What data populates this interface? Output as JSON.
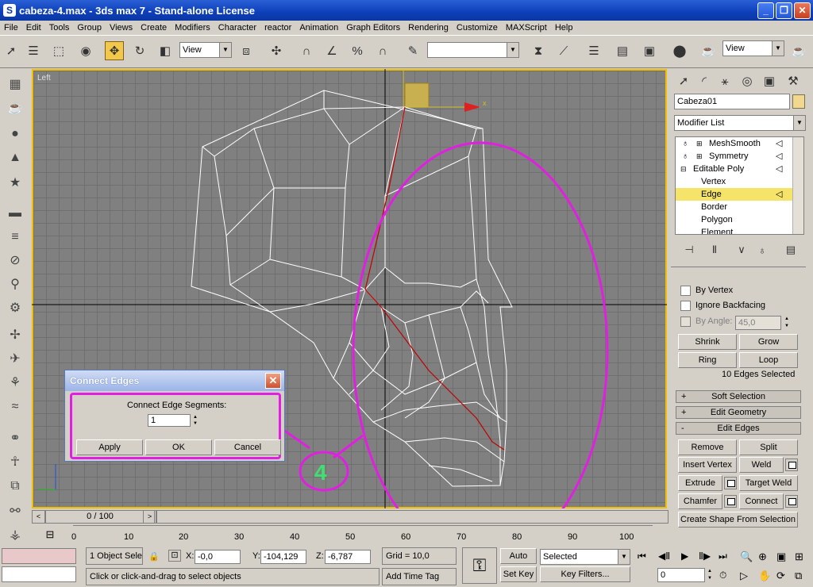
{
  "window": {
    "title": "cabeza-4.max - 3ds max 7 - Stand-alone License",
    "min": "_",
    "max": "❐",
    "close": "✕"
  },
  "menu": [
    "File",
    "Edit",
    "Tools",
    "Group",
    "Views",
    "Create",
    "Modifiers",
    "Character",
    "reactor",
    "Animation",
    "Graph Editors",
    "Rendering",
    "Customize",
    "MAXScript",
    "Help"
  ],
  "toolbar": {
    "ref_coord": "View",
    "named_selection": "",
    "render_view": "View"
  },
  "viewport": {
    "label": "Left",
    "axis_x": "x",
    "annotation_number": "4"
  },
  "dialog": {
    "title": "Connect Edges",
    "close": "✕",
    "segments_label": "Connect Edge Segments:",
    "segments_value": "1",
    "apply": "Apply",
    "ok": "OK",
    "cancel": "Cancel"
  },
  "command_panel": {
    "object_name": "Cabeza01",
    "modifier_list": "Modifier List",
    "stack": [
      {
        "label": "MeshSmooth",
        "level": 0,
        "expand": true,
        "bulb": true,
        "selected": false
      },
      {
        "label": "Symmetry",
        "level": 0,
        "expand": true,
        "bulb": true,
        "selected": false
      },
      {
        "label": "Editable Poly",
        "level": 0,
        "expand": true,
        "bulb": false,
        "selected": false
      },
      {
        "label": "Vertex",
        "level": 1,
        "selected": false
      },
      {
        "label": "Edge",
        "level": 1,
        "selected": true
      },
      {
        "label": "Border",
        "level": 1,
        "selected": false
      },
      {
        "label": "Polygon",
        "level": 1,
        "selected": false
      },
      {
        "label": "Element",
        "level": 1,
        "selected": false
      }
    ],
    "by_vertex": "By Vertex",
    "ignore_backfacing": "Ignore Backfacing",
    "by_angle": "By Angle:",
    "angle_value": "45,0",
    "shrink": "Shrink",
    "grow": "Grow",
    "ring": "Ring",
    "loop": "Loop",
    "selection_count": "10 Edges Selected",
    "soft_selection": "Soft Selection",
    "edit_geometry": "Edit Geometry",
    "edit_edges": "Edit Edges",
    "remove": "Remove",
    "split": "Split",
    "insert_vertex": "Insert Vertex",
    "weld": "Weld",
    "extrude": "Extrude",
    "target_weld": "Target Weld",
    "chamfer": "Chamfer",
    "connect": "Connect",
    "create_shape": "Create Shape From Selection"
  },
  "timeline": {
    "slider": "0 / 100",
    "ticks": [
      "0",
      "10",
      "20",
      "30",
      "40",
      "50",
      "60",
      "70",
      "80",
      "90",
      "100"
    ]
  },
  "status": {
    "selection": "1 Object Sele",
    "x_label": "X:",
    "x_value": "-0,0",
    "y_label": "Y:",
    "y_value": "-104,129",
    "z_label": "Z:",
    "z_value": "-6,787",
    "grid": "Grid = 10,0",
    "prompt": "Click or click-and-drag to select objects",
    "add_time_tag": "Add Time Tag",
    "auto_key": "Auto Key",
    "set_key": "Set Key",
    "key_mode": "Selected",
    "key_filters": "Key Filters...",
    "frame": "0"
  }
}
